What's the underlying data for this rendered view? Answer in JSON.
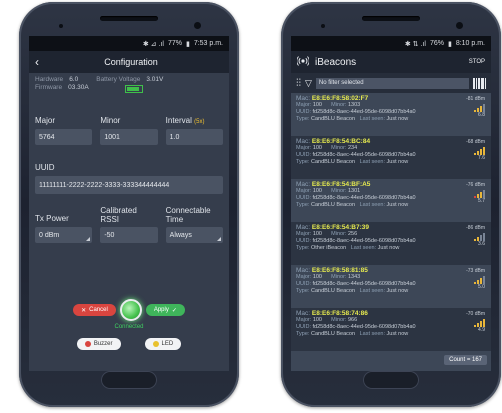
{
  "config_phone": {
    "status": {
      "icons": "✱ ⊿ .ıl",
      "battery": "77%",
      "time": "7:53 p.m."
    },
    "back_glyph": "‹",
    "title": "Configuration",
    "hardware_label": "Hardware",
    "hardware_value": "6.0",
    "firmware_label": "Firmware",
    "firmware_value": "03.30A",
    "battery_voltage_label": "Battery Voltage",
    "battery_voltage_value": "3.01V",
    "major_label": "Major",
    "major_value": "5764",
    "minor_label": "Minor",
    "minor_value": "1001",
    "interval_label": "Interval",
    "interval_unit": "(5x)",
    "interval_value": "1.0",
    "uuid_label": "UUID",
    "uuid_value": "11111111-2222-2222-3333-333344444444",
    "tx_power_label": "Tx Power",
    "tx_power_value": "0 dBm",
    "rssi_label": "Calibrated RSSI",
    "rssi_value": "-50",
    "connectable_label": "Connectable Time",
    "connectable_value": "Always",
    "cancel_label": "Cancel",
    "apply_label": "Apply",
    "connected_label": "Connected",
    "buzzer_label": "Buzzer",
    "led_label": "LED",
    "colors": {
      "accent": "#f2c230",
      "green": "#3fb55b",
      "red": "#d9453f"
    }
  },
  "ibeacons_phone": {
    "status": {
      "icons": "✱ ⇅ .ıl",
      "battery": "76%",
      "time": "8:10 p.m."
    },
    "title": "iBeacons",
    "stop_label": "STOP",
    "filter_text": "No filter selected",
    "field_labels": {
      "mac": "Mac:",
      "major": "Major:",
      "minor": "Minor:",
      "uuid": "UUID:",
      "type": "Type:",
      "last_seen": "Last seen:"
    },
    "beacons": [
      {
        "mac": "E8:E6:F8:58:02:F7",
        "major": "100",
        "minor": "1303",
        "uuid": "fd258d8c-8aec-44ed-95de-6098d07bb4a0",
        "type": "CandBLU Beacon",
        "last_seen": "Just now",
        "rssi": "-81 dBm",
        "sub": "6.8"
      },
      {
        "mac": "E8:E6:F8:54:BC:84",
        "major": "100",
        "minor": "234",
        "uuid": "fd258d8c-8aec-44ed-95de-6098d07bb4a0",
        "type": "CandBLU Beacon",
        "last_seen": "Just now",
        "rssi": "-68 dBm",
        "sub": "7.6"
      },
      {
        "mac": "E8:E6:F8:54:BF:A5",
        "major": "100",
        "minor": "1301",
        "uuid": "fd258d8c-8aec-44ed-95de-6098d07bb4a0",
        "type": "CandBLU Beacon",
        "last_seen": "Just now",
        "rssi": "-76 dBm",
        "sub": "5.7"
      },
      {
        "mac": "E8:E6:F8:54:B7:39",
        "major": "100",
        "minor": "256",
        "uuid": "fd258d8c-8aec-44ed-95de-6098d07bb4a0",
        "type": "Other iBeacon",
        "last_seen": "Just now",
        "rssi": "-86 dBm",
        "sub": "3.6"
      },
      {
        "mac": "E8:E6:F8:58:81:85",
        "major": "100",
        "minor": "1343",
        "uuid": "fd258d8c-8aec-44ed-95de-6098d07bb4a0",
        "type": "CandBLU Beacon",
        "last_seen": "Just now",
        "rssi": "-73 dBm",
        "sub": "5.0"
      },
      {
        "mac": "E8:E6:F8:58:74:86",
        "major": "100",
        "minor": "966",
        "uuid": "fd258d8c-8aec-44ed-95de-6098d07bb4a0",
        "type": "CandBLU Beacon",
        "last_seen": "Just now",
        "rssi": "-70 dBm",
        "sub": "4.9"
      }
    ],
    "count_label": "Count = 167",
    "colors": {
      "mac": "#e8ec4f",
      "signal": "#e8b63a"
    }
  }
}
